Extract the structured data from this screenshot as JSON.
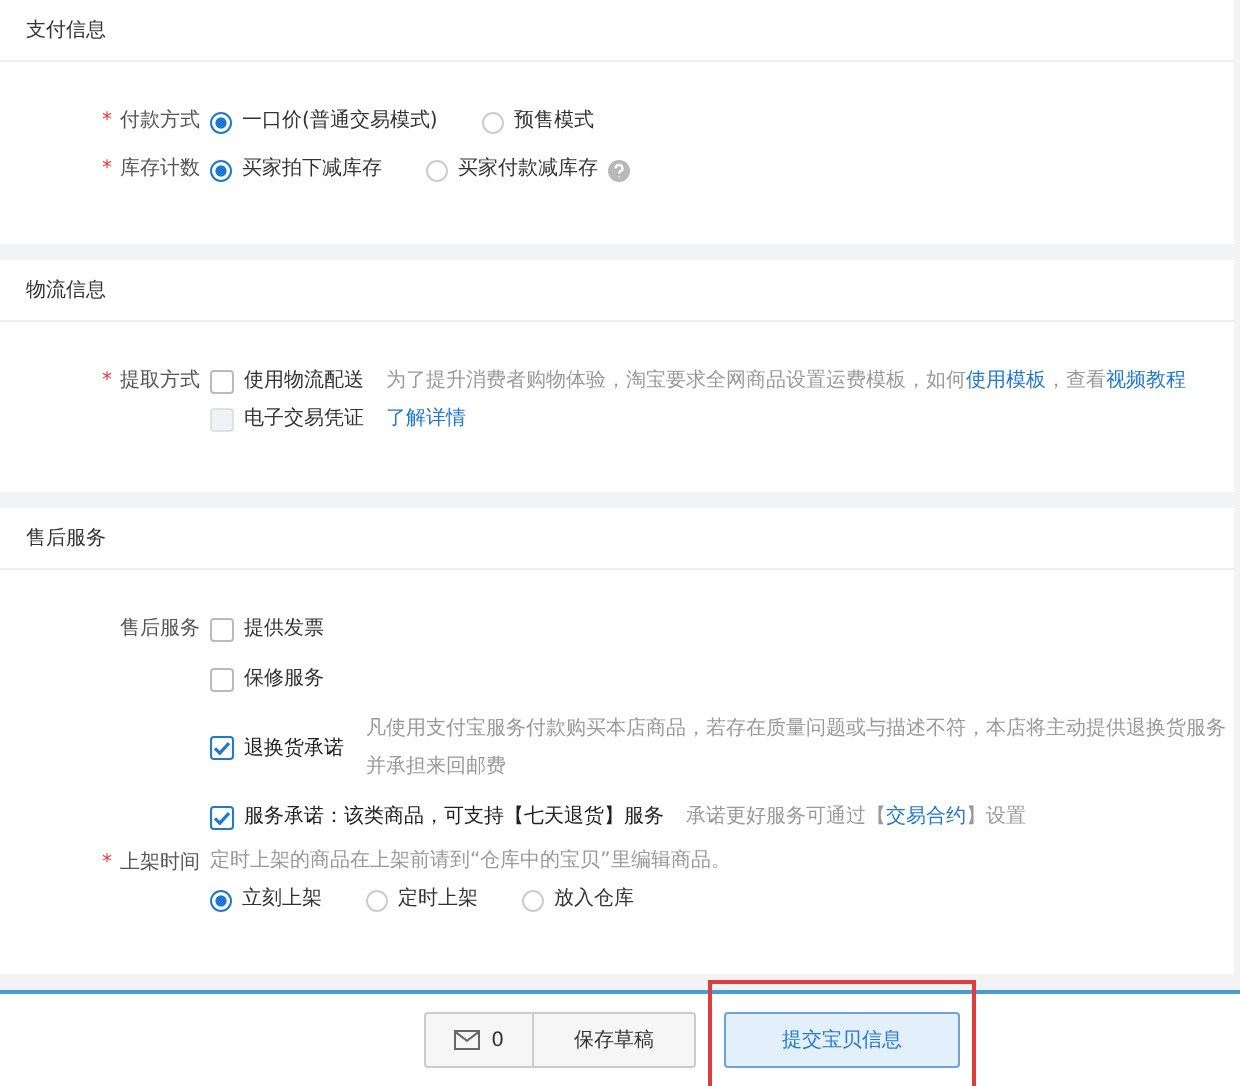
{
  "sections": [
    {
      "title": "支付信息",
      "fields": [
        {
          "label": "付款方式",
          "required_mark": "*",
          "kind": "radio",
          "options": [
            {
              "label": "一口价(普通交易模式)",
              "selected": true
            },
            {
              "label": "预售模式",
              "selected": false
            }
          ]
        },
        {
          "label": "库存计数",
          "required_mark": "*",
          "kind": "radio",
          "options": [
            {
              "label": "买家拍下减库存",
              "selected": true
            },
            {
              "label": "买家付款减库存",
              "selected": false,
              "help": true
            }
          ]
        }
      ]
    },
    {
      "title": "物流信息",
      "fields": [
        {
          "label": "提取方式",
          "required_mark": "*",
          "kind": "checkbox",
          "options": [
            {
              "label": "使用物流配送",
              "checked": false,
              "disabled": false,
              "note": [
                {
                  "text": "为了提升消费者购物体验，淘宝要求全网商品设置运费模板，如何",
                  "kind": "text"
                },
                {
                  "text": "使用模板",
                  "kind": "link"
                },
                {
                  "text": "，查看",
                  "kind": "text"
                },
                {
                  "text": "视频教程",
                  "kind": "link"
                }
              ]
            },
            {
              "label": "电子交易凭证",
              "checked": false,
              "disabled": true,
              "link": "了解详情"
            }
          ]
        }
      ]
    },
    {
      "title": "售后服务",
      "fields": [
        {
          "label": "售后服务",
          "kind": "checkbox",
          "spaced": true,
          "options": [
            {
              "label": "提供发票",
              "checked": false,
              "disabled": false
            },
            {
              "label": "保修服务",
              "checked": false,
              "disabled": false
            },
            {
              "label": "退换货承诺",
              "checked": true,
              "disabled": false,
              "note": [
                {
                  "text": "凡使用支付宝服务付款购买本店商品，若存在质量问题或与描述不符，本店将主动提供退换货服务并承担来回邮费",
                  "kind": "text"
                }
              ]
            },
            {
              "label": "服务承诺：该类商品，可支持【七天退货】服务",
              "checked": true,
              "disabled": false,
              "note": [
                {
                  "text": "承诺更好服务可通过【",
                  "kind": "text"
                },
                {
                  "text": "交易合约",
                  "kind": "link"
                },
                {
                  "text": "】设置",
                  "kind": "text"
                }
              ]
            }
          ]
        },
        {
          "label": "上架时间",
          "required_mark": "*",
          "kind": "radio",
          "hint": "定时上架的商品在上架前请到“仓库中的宝贝”里编辑商品。",
          "options": [
            {
              "label": "立刻上架",
              "selected": true
            },
            {
              "label": "定时上架",
              "selected": false
            },
            {
              "label": "放入仓库",
              "selected": false
            }
          ]
        }
      ]
    }
  ],
  "footer": {
    "message_count": "0",
    "save_label": "保存草稿",
    "submit": {
      "label": "提交宝贝信息",
      "highlighted": true
    }
  }
}
